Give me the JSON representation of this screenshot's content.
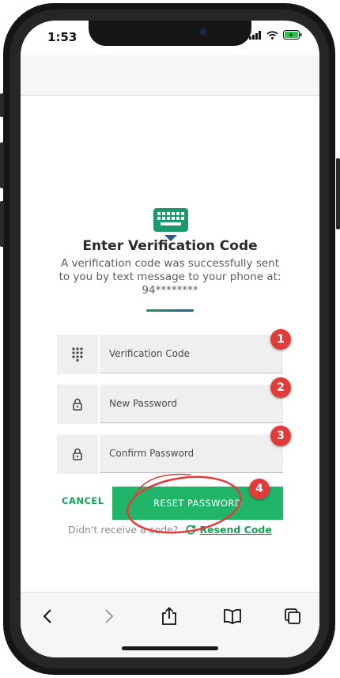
{
  "status_bar": {
    "time": "1:53"
  },
  "page": {
    "title": "Enter Verification Code",
    "description": "A verification code was successfully sent to you by text message to your phone at: 94********"
  },
  "fields": [
    {
      "placeholder": "Verification Code",
      "icon": "keypad-icon"
    },
    {
      "placeholder": "New Password",
      "icon": "lock-icon"
    },
    {
      "placeholder": "Confirm Password",
      "icon": "lock-icon"
    }
  ],
  "actions": {
    "cancel_label": "CANCEL",
    "reset_label": "RESET PASSWORD"
  },
  "resend": {
    "prompt": "Didn't receive a code?",
    "link_label": "Resend Code"
  },
  "annotations": [
    "1",
    "2",
    "3",
    "4"
  ],
  "colors": {
    "accent": "#21b56a",
    "badge": "#e33a3a",
    "annotation_stroke": "#e33a3a"
  },
  "browser_toolbar": [
    "back-icon",
    "forward-icon",
    "share-icon",
    "bookmarks-icon",
    "tabs-icon"
  ]
}
